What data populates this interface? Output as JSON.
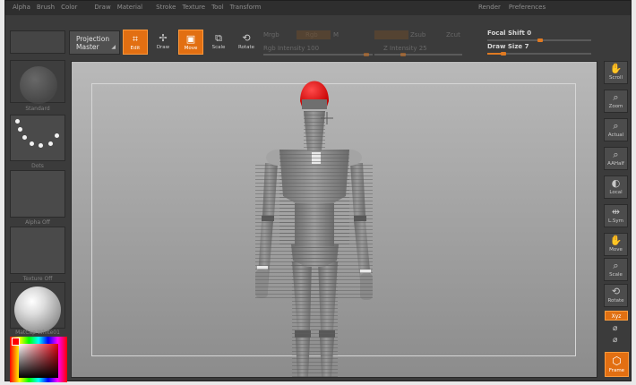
{
  "menu": {
    "left": [
      "Alpha",
      "Brush",
      "Color",
      "Draw",
      "Material",
      "Stroke",
      "Texture",
      "Tool",
      "Transform"
    ],
    "right": [
      "Render",
      "Preferences"
    ]
  },
  "toolbar": {
    "projection_master_label": "Projection Master",
    "edit_label": "Edit",
    "draw_label": "Draw",
    "move_label": "Move",
    "scale_label": "Scale",
    "rotate_label": "Rotate",
    "mrgb": "Mrgb",
    "rgb": "Rgb",
    "m": "M",
    "rgb_intensity": "Rgb Intensity 100",
    "zadd": "Zadd",
    "zsub": "Zsub",
    "zcut": "Zcut",
    "z_intensity": "Z Intensity 25",
    "focal_shift_label": "Focal Shift",
    "focal_shift_value": "0",
    "draw_size_label": "Draw Size",
    "draw_size_value": "7"
  },
  "left_palette": {
    "brush_label": "Standard",
    "stroke_label": "Dots",
    "alpha_label": "Alpha Off",
    "texture_label": "Texture Off",
    "material_label": "MatCap White01"
  },
  "right_palette": {
    "buttons": [
      "Scroll",
      "Zoom",
      "Actual",
      "AAHalf",
      "Local",
      "L.Sym",
      "Move",
      "Scale",
      "Rotate"
    ],
    "xyz_label": "Xyz",
    "frame_label": "Frame"
  },
  "colors": {
    "accent": "#e26f12",
    "head": "#e00000",
    "background": "#3b3b3b"
  }
}
